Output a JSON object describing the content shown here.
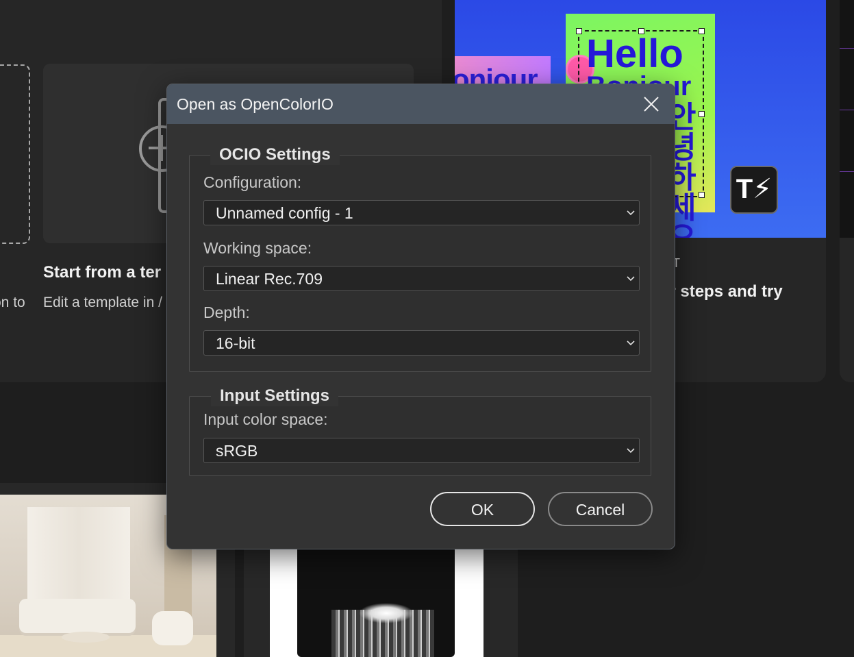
{
  "background": {
    "left_card": {
      "title": "Start from a ter",
      "description": "Edit a template in /",
      "clipped_text": "on to"
    },
    "right_card": {
      "hero_text_1": "Hello",
      "hero_text_2": "Bonjour",
      "hero_text_3": "안녕하세요",
      "side_text": "onjour",
      "kicker": "T",
      "title": "er steps and try"
    }
  },
  "dialog": {
    "title": "Open as OpenColorIO",
    "ocio_settings": {
      "legend": "OCIO Settings",
      "configuration": {
        "label": "Configuration:",
        "value": "Unnamed config - 1"
      },
      "working_space": {
        "label": "Working space:",
        "value": "Linear Rec.709"
      },
      "depth": {
        "label": "Depth:",
        "value": "16-bit"
      }
    },
    "input_settings": {
      "legend": "Input Settings",
      "input_color_space": {
        "label": "Input color space:",
        "value": "sRGB"
      }
    },
    "buttons": {
      "ok": "OK",
      "cancel": "Cancel"
    }
  },
  "colors": {
    "titlebar": "#4b5561",
    "dialog_bg": "#333333",
    "hero_blue": "#2b49e6",
    "hero_green": "#7cf562"
  }
}
